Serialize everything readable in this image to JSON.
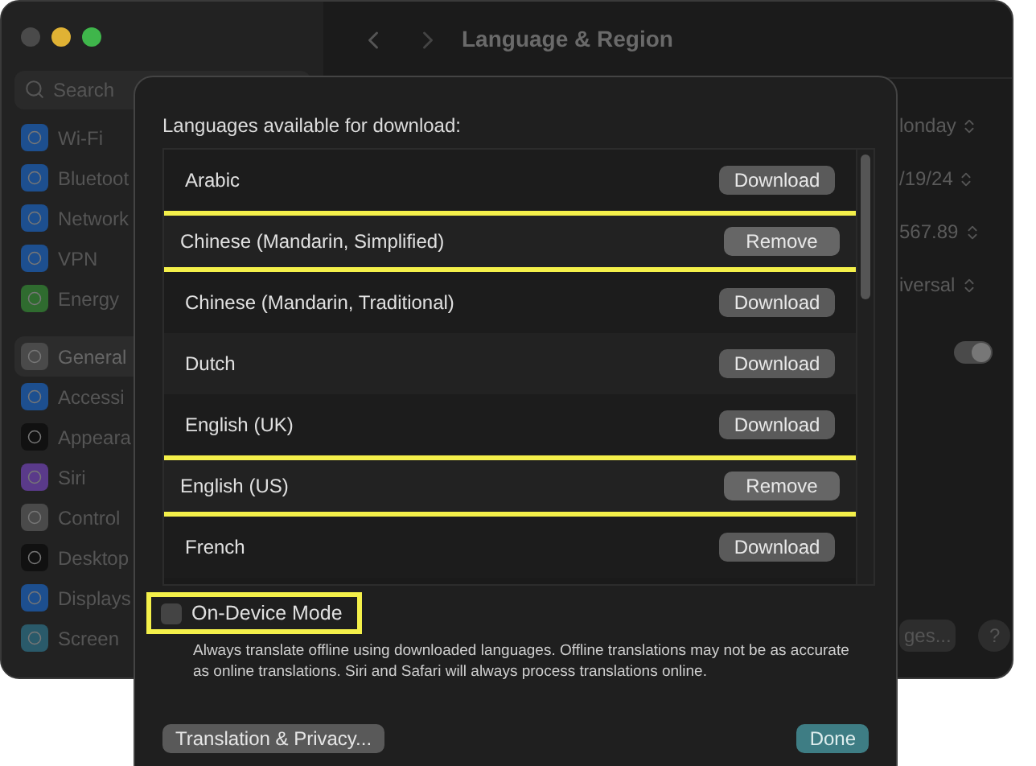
{
  "window": {
    "title": "Language & Region"
  },
  "sidebar": {
    "search": {
      "placeholder": "Search"
    },
    "groups": [
      [
        {
          "label": "Wi-Fi",
          "color": "#1d4f8f",
          "selected": false
        },
        {
          "label": "Bluetoot",
          "color": "#1d4f8f",
          "selected": false
        },
        {
          "label": "Network",
          "color": "#1d4f8f",
          "selected": false
        },
        {
          "label": "VPN",
          "color": "#1d4f8f",
          "selected": false
        },
        {
          "label": "Energy",
          "color": "#2f6b2f",
          "selected": false
        }
      ],
      [
        {
          "label": "General",
          "color": "#4a4a4a",
          "selected": true
        },
        {
          "label": "Accessi",
          "color": "#1d4f8f",
          "selected": false
        },
        {
          "label": "Appeara",
          "color": "#111111",
          "selected": false
        },
        {
          "label": "Siri",
          "color": "#5a3a8a",
          "selected": false
        },
        {
          "label": "Control",
          "color": "#4a4a4a",
          "selected": false
        },
        {
          "label": "Desktop",
          "color": "#111111",
          "selected": false
        },
        {
          "label": "Displays",
          "color": "#1d4f8f",
          "selected": false
        },
        {
          "label": "Screen",
          "color": "#2a5a6a",
          "selected": false
        }
      ]
    ]
  },
  "settings": {
    "popups": [
      "londay",
      "/19/24",
      "567.89",
      "iversal"
    ],
    "toggle": {
      "on": true
    },
    "button": "ges...",
    "help": "?"
  },
  "sheet": {
    "heading": "Languages available for download:",
    "languages": [
      {
        "name": "Arabic",
        "action": "Download",
        "downloaded": false,
        "highlighted": false
      },
      {
        "name": "Chinese (Mandarin, Simplified)",
        "action": "Remove",
        "downloaded": true,
        "highlighted": true
      },
      {
        "name": "Chinese (Mandarin, Traditional)",
        "action": "Download",
        "downloaded": false,
        "highlighted": false
      },
      {
        "name": "Dutch",
        "action": "Download",
        "downloaded": false,
        "highlighted": false
      },
      {
        "name": "English (UK)",
        "action": "Download",
        "downloaded": false,
        "highlighted": false
      },
      {
        "name": "English (US)",
        "action": "Remove",
        "downloaded": true,
        "highlighted": true
      },
      {
        "name": "French",
        "action": "Download",
        "downloaded": false,
        "highlighted": false
      }
    ],
    "on_device_mode": {
      "label": "On-Device Mode",
      "checked": false,
      "highlighted": true,
      "description": "Always translate offline using downloaded languages. Offline translations may not be as accurate as online translations. Siri and Safari will always process translations online."
    },
    "buttons": [
      {
        "label": "Translation & Privacy...",
        "kind": "secondary"
      },
      {
        "label": "Done",
        "kind": "primary"
      }
    ]
  }
}
